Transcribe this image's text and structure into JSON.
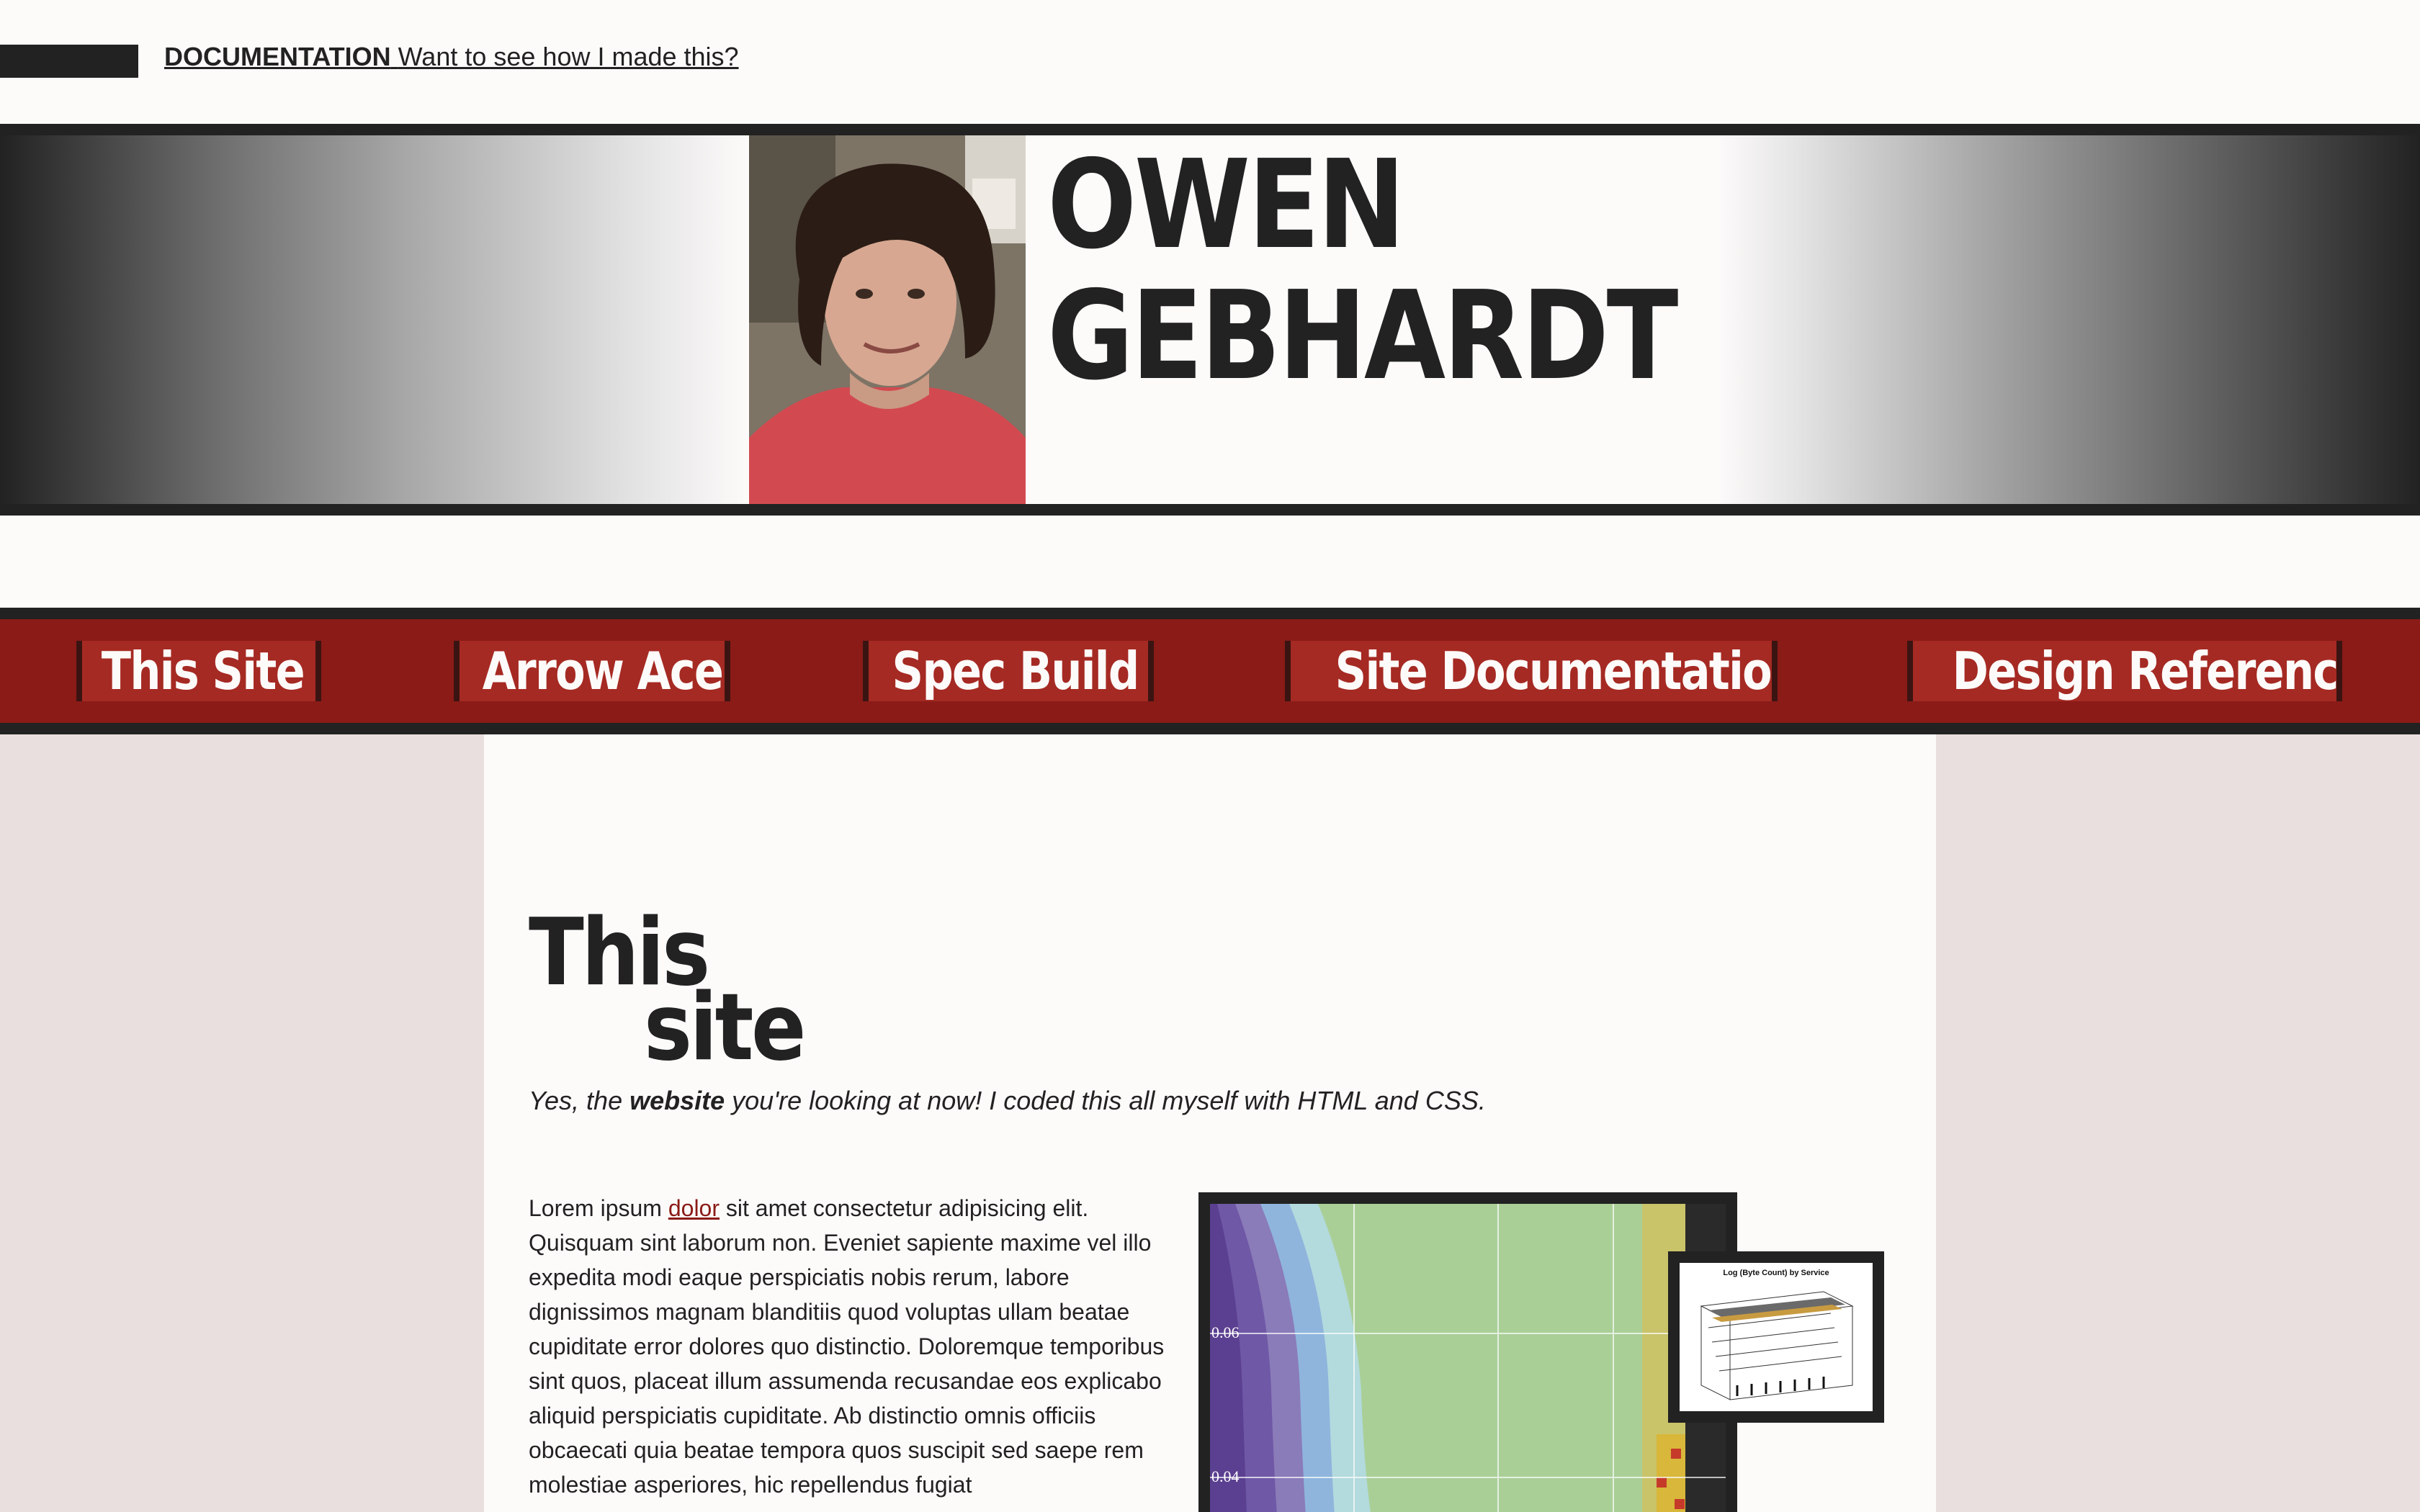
{
  "doc_bar": {
    "doc_label": "DOCUMENTATION",
    "doc_text": "Want to see how I made this?"
  },
  "header": {
    "name_line1": "OWEN",
    "name_line2": "GEBHARDT"
  },
  "nav": {
    "items": [
      {
        "label": "This Site"
      },
      {
        "label": "Arrow Ace"
      },
      {
        "label": "Spec Build"
      },
      {
        "label": "Site Documentation"
      },
      {
        "label": "Design Reference"
      }
    ]
  },
  "main": {
    "heading_word1": "This",
    "heading_word2": "site",
    "tagline_pre": "Yes, the ",
    "tagline_bold": "website",
    "tagline_post": " you're looking at now! I coded this all myself with HTML and CSS.",
    "body_pre": "Lorem ipsum ",
    "body_link": "dolor",
    "body_post": " sit amet consectetur adipisicing elit. Quisquam sint laborum non. Eveniet sapiente maxime vel illo expedita modi eaque perspiciatis nobis rerum, labore dignissimos magnam blanditiis quod voluptas ullam beatae cupiditate error dolores quo distinctio. Doloremque temporibus sint quos, placeat illum assumenda recusandae eos explicabo aliquid perspiciatis cupiditate. Ab distinctio omnis officiis obcaecati quia beatae tempora quos suscipit sed saepe rem molestiae asperiores, hic repellendus fugiat",
    "figure_ticks": [
      "0.06",
      "0.04"
    ],
    "inset_title": "Log (Byte Count) by Service"
  },
  "colors": {
    "dark": "#222222",
    "nav_red": "#8a1b17",
    "nav_tab": "#a52a23",
    "page_bg": "#eadfdf",
    "content_bg": "#fdfbfa"
  }
}
